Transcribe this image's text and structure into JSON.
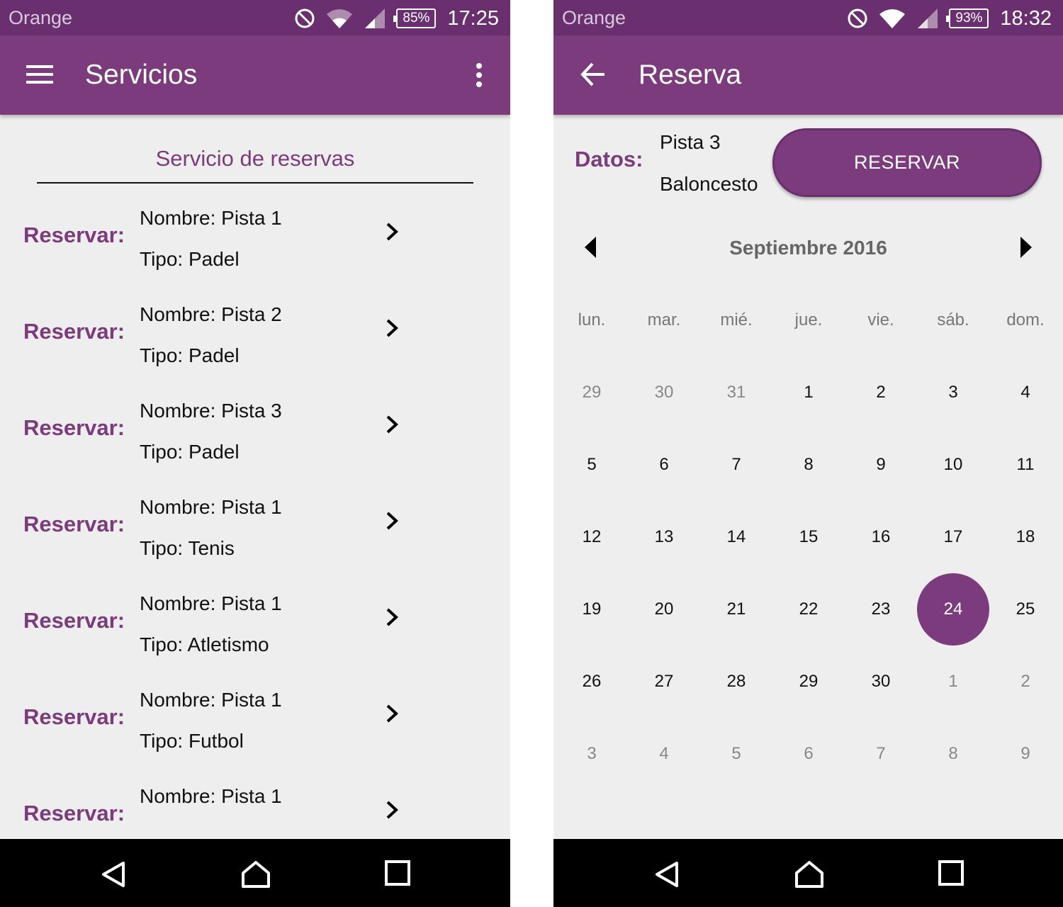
{
  "colors": {
    "primary": "#7b3b7c",
    "status_bar": "#6a2f6f",
    "background": "#eeeeee",
    "nav_bar": "#000000"
  },
  "left": {
    "status": {
      "carrier": "Orange",
      "battery": "85%",
      "time": "17:25"
    },
    "appbar": {
      "title": "Servicios",
      "menu_icon": "hamburger-icon",
      "overflow_icon": "more-vert-icon"
    },
    "list_header": "Servicio de reservas",
    "items": [
      {
        "label": "Reservar:",
        "nombre": "Nombre: Pista 1",
        "tipo": "Tipo: Padel"
      },
      {
        "label": "Reservar:",
        "nombre": "Nombre: Pista 2",
        "tipo": "Tipo: Padel"
      },
      {
        "label": "Reservar:",
        "nombre": "Nombre: Pista 3",
        "tipo": "Tipo: Padel"
      },
      {
        "label": "Reservar:",
        "nombre": "Nombre: Pista 1",
        "tipo": "Tipo: Tenis"
      },
      {
        "label": "Reservar:",
        "nombre": "Nombre: Pista 1",
        "tipo": "Tipo: Atletismo"
      },
      {
        "label": "Reservar:",
        "nombre": "Nombre: Pista 1",
        "tipo": "Tipo: Futbol"
      },
      {
        "label": "Reservar:",
        "nombre": "Nombre: Pista 1",
        "tipo": ""
      }
    ]
  },
  "right": {
    "status": {
      "carrier": "Orange",
      "battery": "93%",
      "time": "18:32"
    },
    "appbar": {
      "title": "Reserva",
      "back_icon": "arrow-back-icon"
    },
    "datos": {
      "label": "Datos:",
      "pista": "Pista 3",
      "deporte": "Baloncesto"
    },
    "reserve_button": "RESERVAR",
    "calendar": {
      "month": "Septiembre 2016",
      "weekdays": [
        "lun.",
        "mar.",
        "mié.",
        "jue.",
        "vie.",
        "sáb.",
        "dom."
      ],
      "weeks": [
        [
          "29",
          "30",
          "31",
          "1",
          "2",
          "3",
          "4"
        ],
        [
          "5",
          "6",
          "7",
          "8",
          "9",
          "10",
          "11"
        ],
        [
          "12",
          "13",
          "14",
          "15",
          "16",
          "17",
          "18"
        ],
        [
          "19",
          "20",
          "21",
          "22",
          "23",
          "24",
          "25"
        ],
        [
          "26",
          "27",
          "28",
          "29",
          "30",
          "1",
          "2"
        ],
        [
          "3",
          "4",
          "5",
          "6",
          "7",
          "8",
          "9"
        ]
      ],
      "selected_day": "24"
    }
  }
}
